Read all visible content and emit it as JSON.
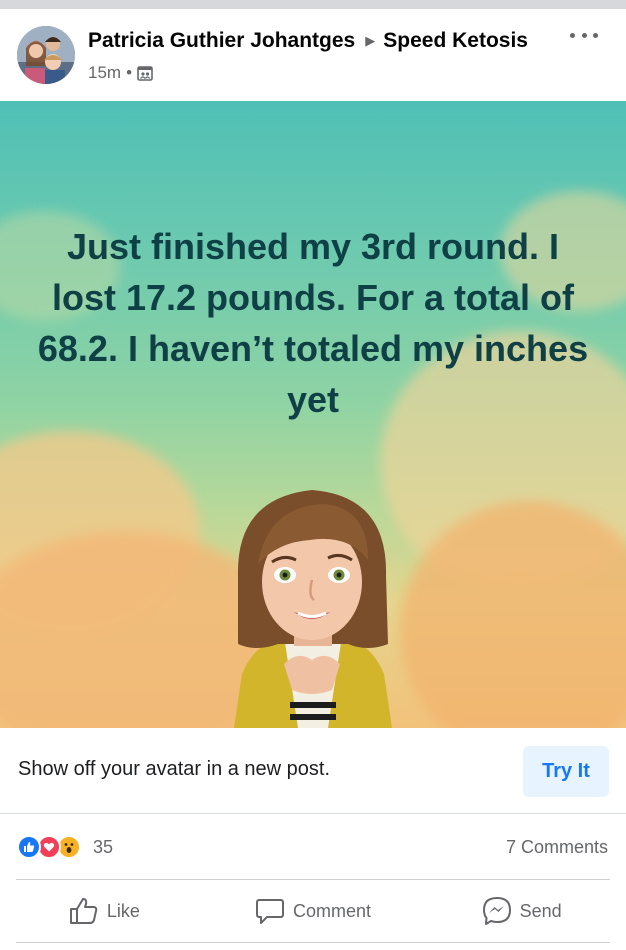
{
  "post": {
    "author": "Patricia Guthier Johantges",
    "group": "Speed Ketosis",
    "time": "15m",
    "separator": "•",
    "body_text": "Just finished my 3rd round. I lost 17.2 pounds. For a total of 68.2. I haven’t totaled my inches yet"
  },
  "icons": {
    "avatar": "profile-photo",
    "privacy": "group-privacy-icon",
    "more": "more-options-icon",
    "like": "like-icon",
    "comment": "comment-icon",
    "send": "messenger-send-icon"
  },
  "cta": {
    "text": "Show off your avatar in a new post.",
    "button_label": "Try It"
  },
  "reactions": {
    "types": [
      "like",
      "love",
      "wow"
    ],
    "count": "35",
    "comments": "7 Comments"
  },
  "actions": {
    "like": "Like",
    "comment": "Comment",
    "send": "Send"
  },
  "colors": {
    "accent": "#1877f2",
    "text_secondary": "#65676b",
    "post_text": "#0e4046",
    "like_blue": "#1877f2",
    "love_red": "#f33e58",
    "wow_yellow": "#f7b125"
  }
}
